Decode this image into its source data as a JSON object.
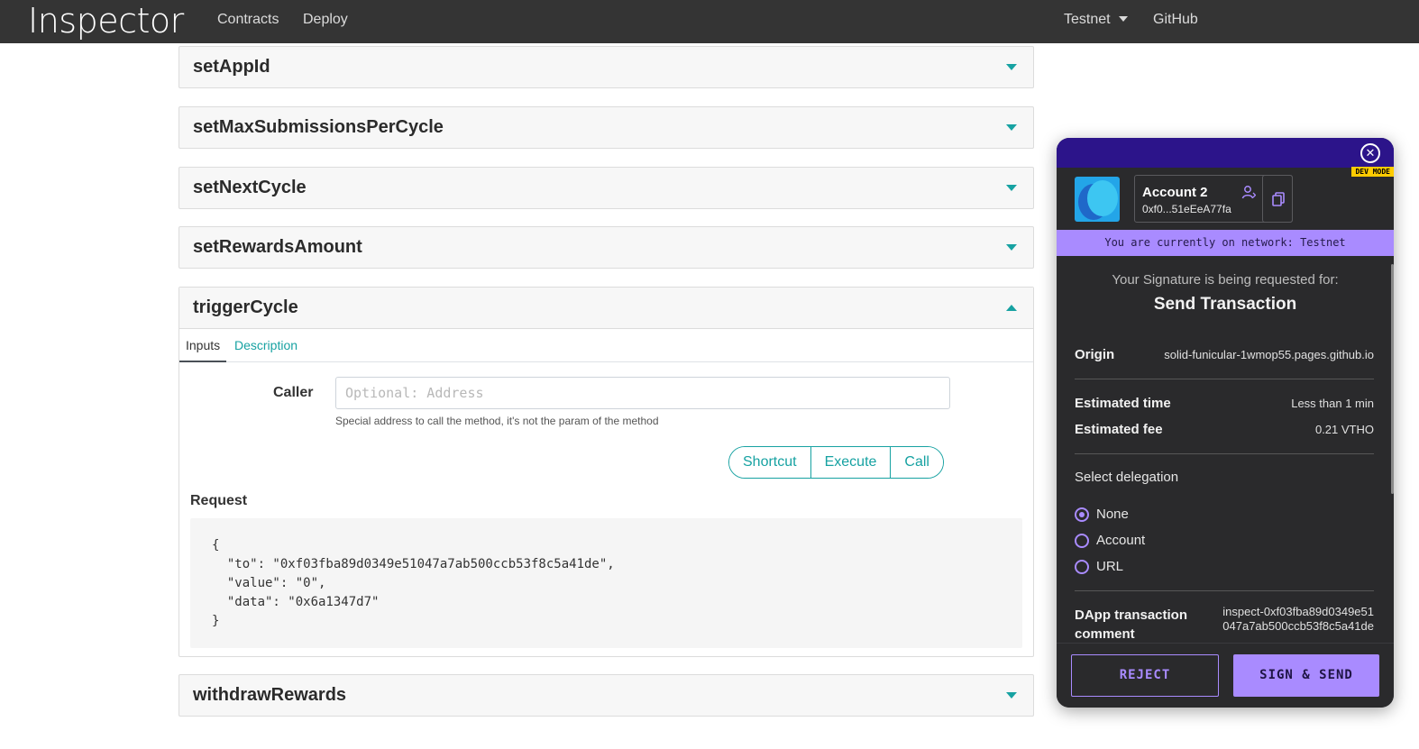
{
  "navbar": {
    "brand": "Inspector",
    "links": {
      "contracts": "Contracts",
      "deploy": "Deploy"
    },
    "network": "Testnet",
    "github": "GitHub"
  },
  "methods": {
    "set_app_id": "setAppId",
    "set_max_submissions": "setMaxSubmissionsPerCycle",
    "set_next_cycle": "setNextCycle",
    "set_rewards_amount": "setRewardsAmount",
    "trigger_cycle": "triggerCycle",
    "withdraw_rewards": "withdrawRewards"
  },
  "trigger_cycle": {
    "tabs": {
      "inputs": "Inputs",
      "description": "Description"
    },
    "caller_label": "Caller",
    "caller_placeholder": "Optional: Address",
    "caller_help": "Special address to call the method, it's not the param of the method",
    "buttons": {
      "shortcut": "Shortcut",
      "execute": "Execute",
      "call": "Call"
    },
    "request_label": "Request",
    "request_body": "{\n  \"to\": \"0xf03fba89d0349e51047a7ab500ccb53f8c5a41de\",\n  \"value\": \"0\",\n  \"data\": \"0x6a1347d7\"\n}"
  },
  "wallet": {
    "dev_mode": "DEV MODE",
    "account_name": "Account 2",
    "account_address": "0xf0...51eEeA77fa",
    "network_banner": "You are currently on network: Testnet",
    "signature_request": "Your Signature is being requested for:",
    "action_title": "Send Transaction",
    "origin_label": "Origin",
    "origin_value": "solid-funicular-1wmop55.pages.github.io",
    "estimated_time_label": "Estimated time",
    "estimated_time_value": "Less than 1 min",
    "estimated_fee_label": "Estimated fee",
    "estimated_fee_value": "0.21 VTHO",
    "select_delegation": "Select delegation",
    "delegation_options": [
      "None",
      "Account",
      "URL"
    ],
    "delegation_selected": "None",
    "comment_label": "DApp transaction comment",
    "comment_value": "inspect-0xf03fba89d0349e51047a7ab500ccb53f8c5a41de",
    "reject": "REJECT",
    "sign_send": "SIGN & SEND"
  },
  "colors": {
    "navbar_bg": "#343434",
    "accent_teal": "#17a2a2",
    "wallet_header": "#2c148a",
    "wallet_accent": "#a98bff",
    "dev_mode_badge": "#ffcc00"
  }
}
